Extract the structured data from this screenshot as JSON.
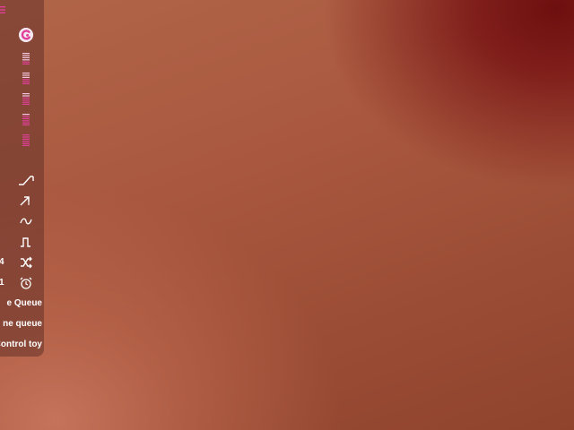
{
  "panel": {
    "side_numbers": {
      "shuffle_row": "4",
      "timer_row": "1"
    },
    "labels": {
      "queue_1": "e Queue",
      "queue_2": "ne queue",
      "control": "Control toy"
    },
    "icons": [
      "menu-icon",
      "toy-logo-icon",
      "level-bars-icon",
      "level-bars-icon",
      "level-bars-icon",
      "level-bars-icon",
      "level-bars-icon",
      "ramp-pattern-icon",
      "rise-pattern-icon",
      "wave-pattern-icon",
      "pulse-pattern-icon",
      "shuffle-icon",
      "alarm-clock-icon"
    ],
    "colors": {
      "accent": "#e0409a",
      "icon": "#ffffff",
      "panel_bg": "#6e372d"
    }
  }
}
